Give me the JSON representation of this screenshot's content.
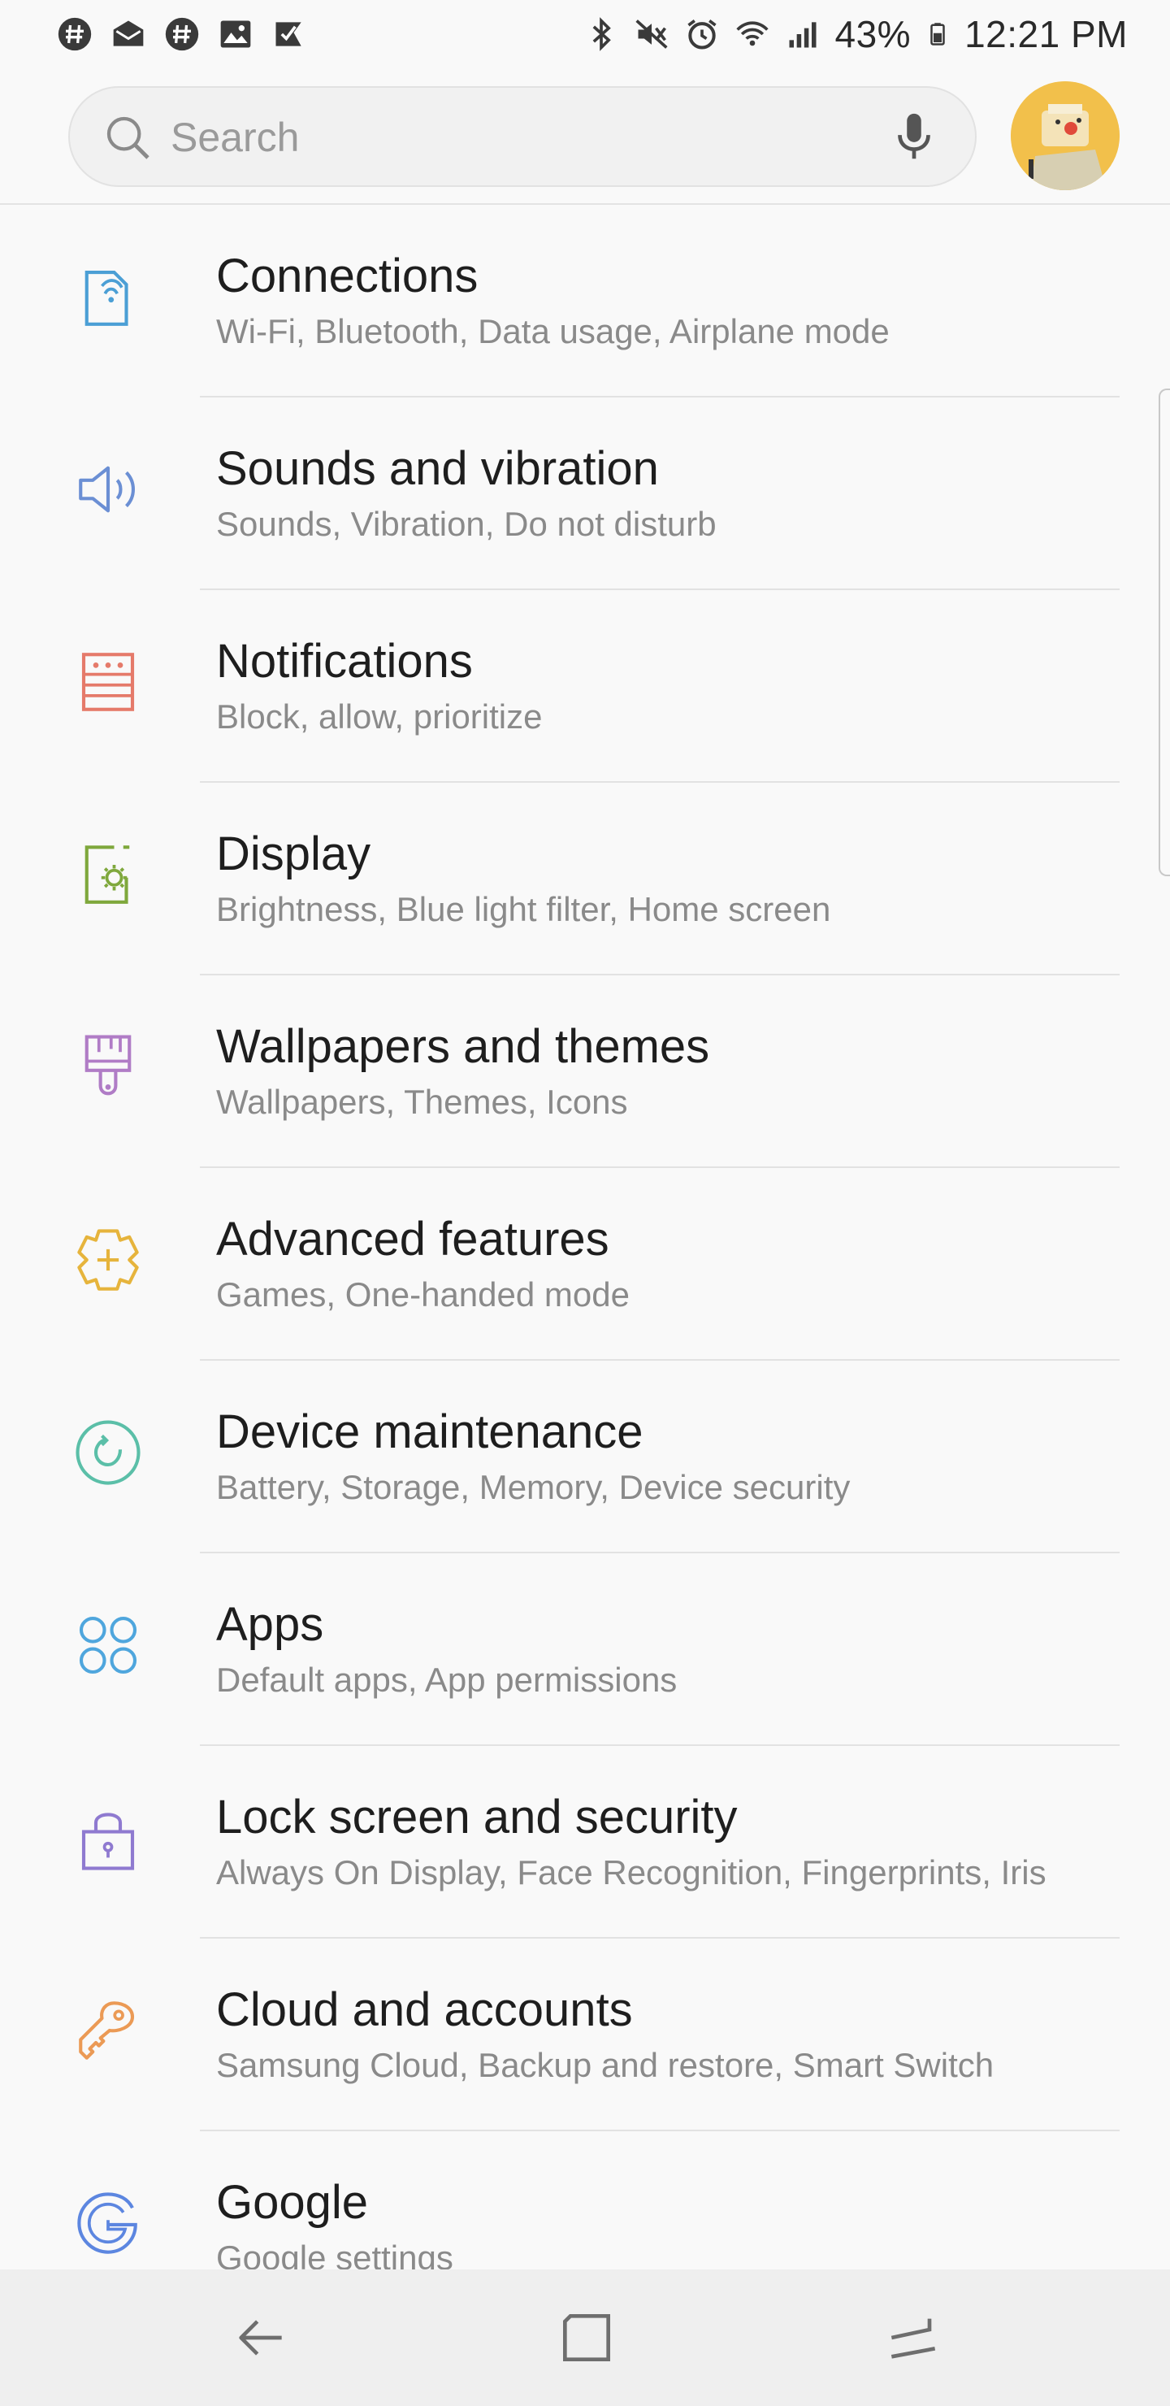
{
  "status_bar": {
    "left_icons": [
      "hashtag-icon",
      "mail-icon",
      "hashtag-icon",
      "image-icon",
      "checkbox-icon"
    ],
    "right_icons": [
      "bluetooth-icon",
      "mute-icon",
      "alarm-icon",
      "wifi-icon",
      "signal-icon",
      "battery-icon"
    ],
    "battery_percent": "43%",
    "time": "12:21 PM"
  },
  "search": {
    "placeholder": "Search"
  },
  "settings": {
    "items": [
      {
        "title": "Connections",
        "subtitle": "Wi-Fi, Bluetooth, Data usage, Airplane mode",
        "icon": "connections-icon",
        "color": "#4b9fd5"
      },
      {
        "title": "Sounds and vibration",
        "subtitle": "Sounds, Vibration, Do not disturb",
        "icon": "speaker-icon",
        "color": "#6b8fd4"
      },
      {
        "title": "Notifications",
        "subtitle": "Block, allow, prioritize",
        "icon": "notifications-icon",
        "color": "#e57a6a"
      },
      {
        "title": "Display",
        "subtitle": "Brightness, Blue light filter, Home screen",
        "icon": "display-icon",
        "color": "#7fa83c"
      },
      {
        "title": "Wallpapers and themes",
        "subtitle": "Wallpapers, Themes, Icons",
        "icon": "paintbrush-icon",
        "color": "#b07cc6"
      },
      {
        "title": "Advanced features",
        "subtitle": "Games, One-handed mode",
        "icon": "gear-plus-icon",
        "color": "#e6b43c"
      },
      {
        "title": "Device maintenance",
        "subtitle": "Battery, Storage, Memory, Device security",
        "icon": "refresh-circle-icon",
        "color": "#5bbfa8"
      },
      {
        "title": "Apps",
        "subtitle": "Default apps, App permissions",
        "icon": "apps-grid-icon",
        "color": "#4fa6dd"
      },
      {
        "title": "Lock screen and security",
        "subtitle": "Always On Display, Face Recognition, Fingerprints, Iris",
        "icon": "lock-icon",
        "color": "#8f7ad0"
      },
      {
        "title": "Cloud and accounts",
        "subtitle": "Samsung Cloud, Backup and restore, Smart Switch",
        "icon": "key-icon",
        "color": "#eb9a55"
      },
      {
        "title": "Google",
        "subtitle": "Google settings",
        "icon": "google-icon",
        "color": "#5c86e0"
      }
    ]
  },
  "nav_bar": {
    "buttons": [
      "back-icon",
      "home-icon",
      "recents-icon"
    ]
  }
}
